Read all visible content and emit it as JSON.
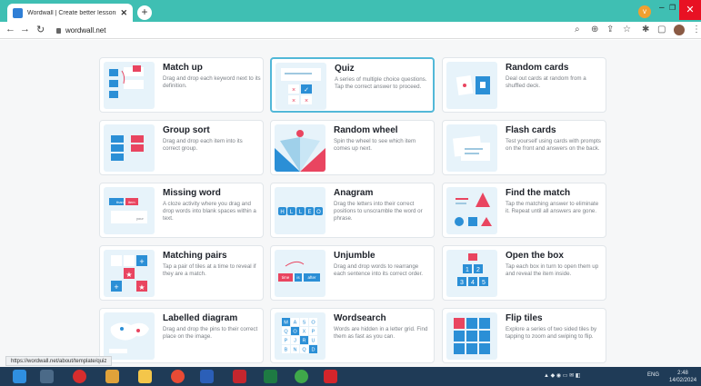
{
  "browser": {
    "tab_title": "Wordwall | Create better lessons",
    "tab_close": "✕",
    "new_tab": "+",
    "url": "wordwall.net",
    "back": "←",
    "forward": "→",
    "reload": "↻",
    "minimize": "–",
    "restore": "❐",
    "close": "✕",
    "profile_initial": "v"
  },
  "cards": [
    {
      "title": "Match up",
      "desc": "Drag and drop each keyword next to its definition."
    },
    {
      "title": "Quiz",
      "desc": "A series of multiple choice questions. Tap the correct answer to proceed."
    },
    {
      "title": "Random cards",
      "desc": "Deal out cards at random from a shuffled deck."
    },
    {
      "title": "Group sort",
      "desc": "Drag and drop each item into its correct group."
    },
    {
      "title": "Random wheel",
      "desc": "Spin the wheel to see which item comes up next."
    },
    {
      "title": "Flash cards",
      "desc": "Test yourself using cards with prompts on the front and answers on the back."
    },
    {
      "title": "Missing word",
      "desc": "A cloze activity where you drag and drop words into blank spaces within a text."
    },
    {
      "title": "Anagram",
      "desc": "Drag the letters into their correct positions to unscramble the word or phrase."
    },
    {
      "title": "Find the match",
      "desc": "Tap the matching answer to eliminate it. Repeat until all answers are gone."
    },
    {
      "title": "Matching pairs",
      "desc": "Tap a pair of tiles at a time to reveal if they are a match."
    },
    {
      "title": "Unjumble",
      "desc": "Drag and drop words to rearrange each sentence into its correct order."
    },
    {
      "title": "Open the box",
      "desc": "Tap each box in turn to open them up and reveal the item inside."
    },
    {
      "title": "Labelled diagram",
      "desc": "Drag and drop the pins to their correct place on the image."
    },
    {
      "title": "Wordsearch",
      "desc": "Words are hidden in a letter grid. Find them as fast as you can."
    },
    {
      "title": "Flip tiles",
      "desc": "Explore a series of two sided tiles by tapping to zoom and swiping to flip."
    }
  ],
  "thumb_text": {
    "anagram_letters": [
      "H",
      "L",
      "L",
      "E",
      "O"
    ],
    "missing_words": [
      "thank",
      "item",
      "your"
    ],
    "unjumble_words": [
      "time",
      "is",
      "after"
    ],
    "wordsearch_letters": [
      "M",
      "A",
      "S",
      "O",
      "Q",
      "O",
      "X",
      "P",
      "P",
      "J",
      "R",
      "U",
      "B",
      "N",
      "Q",
      "D"
    ],
    "openbox_numbers": [
      "1",
      "2",
      "3",
      "4",
      "5"
    ]
  },
  "status_url": "https://wordwall.net/about/template/quiz",
  "taskbar": {
    "time": "2:48",
    "date": "14/02/2024",
    "lang": "ENG"
  },
  "colors": {
    "accent": "#52b8d8",
    "brand_blue": "#2b8fd6",
    "brand_red": "#e94560",
    "tab_strip": "#3fbfb3"
  }
}
